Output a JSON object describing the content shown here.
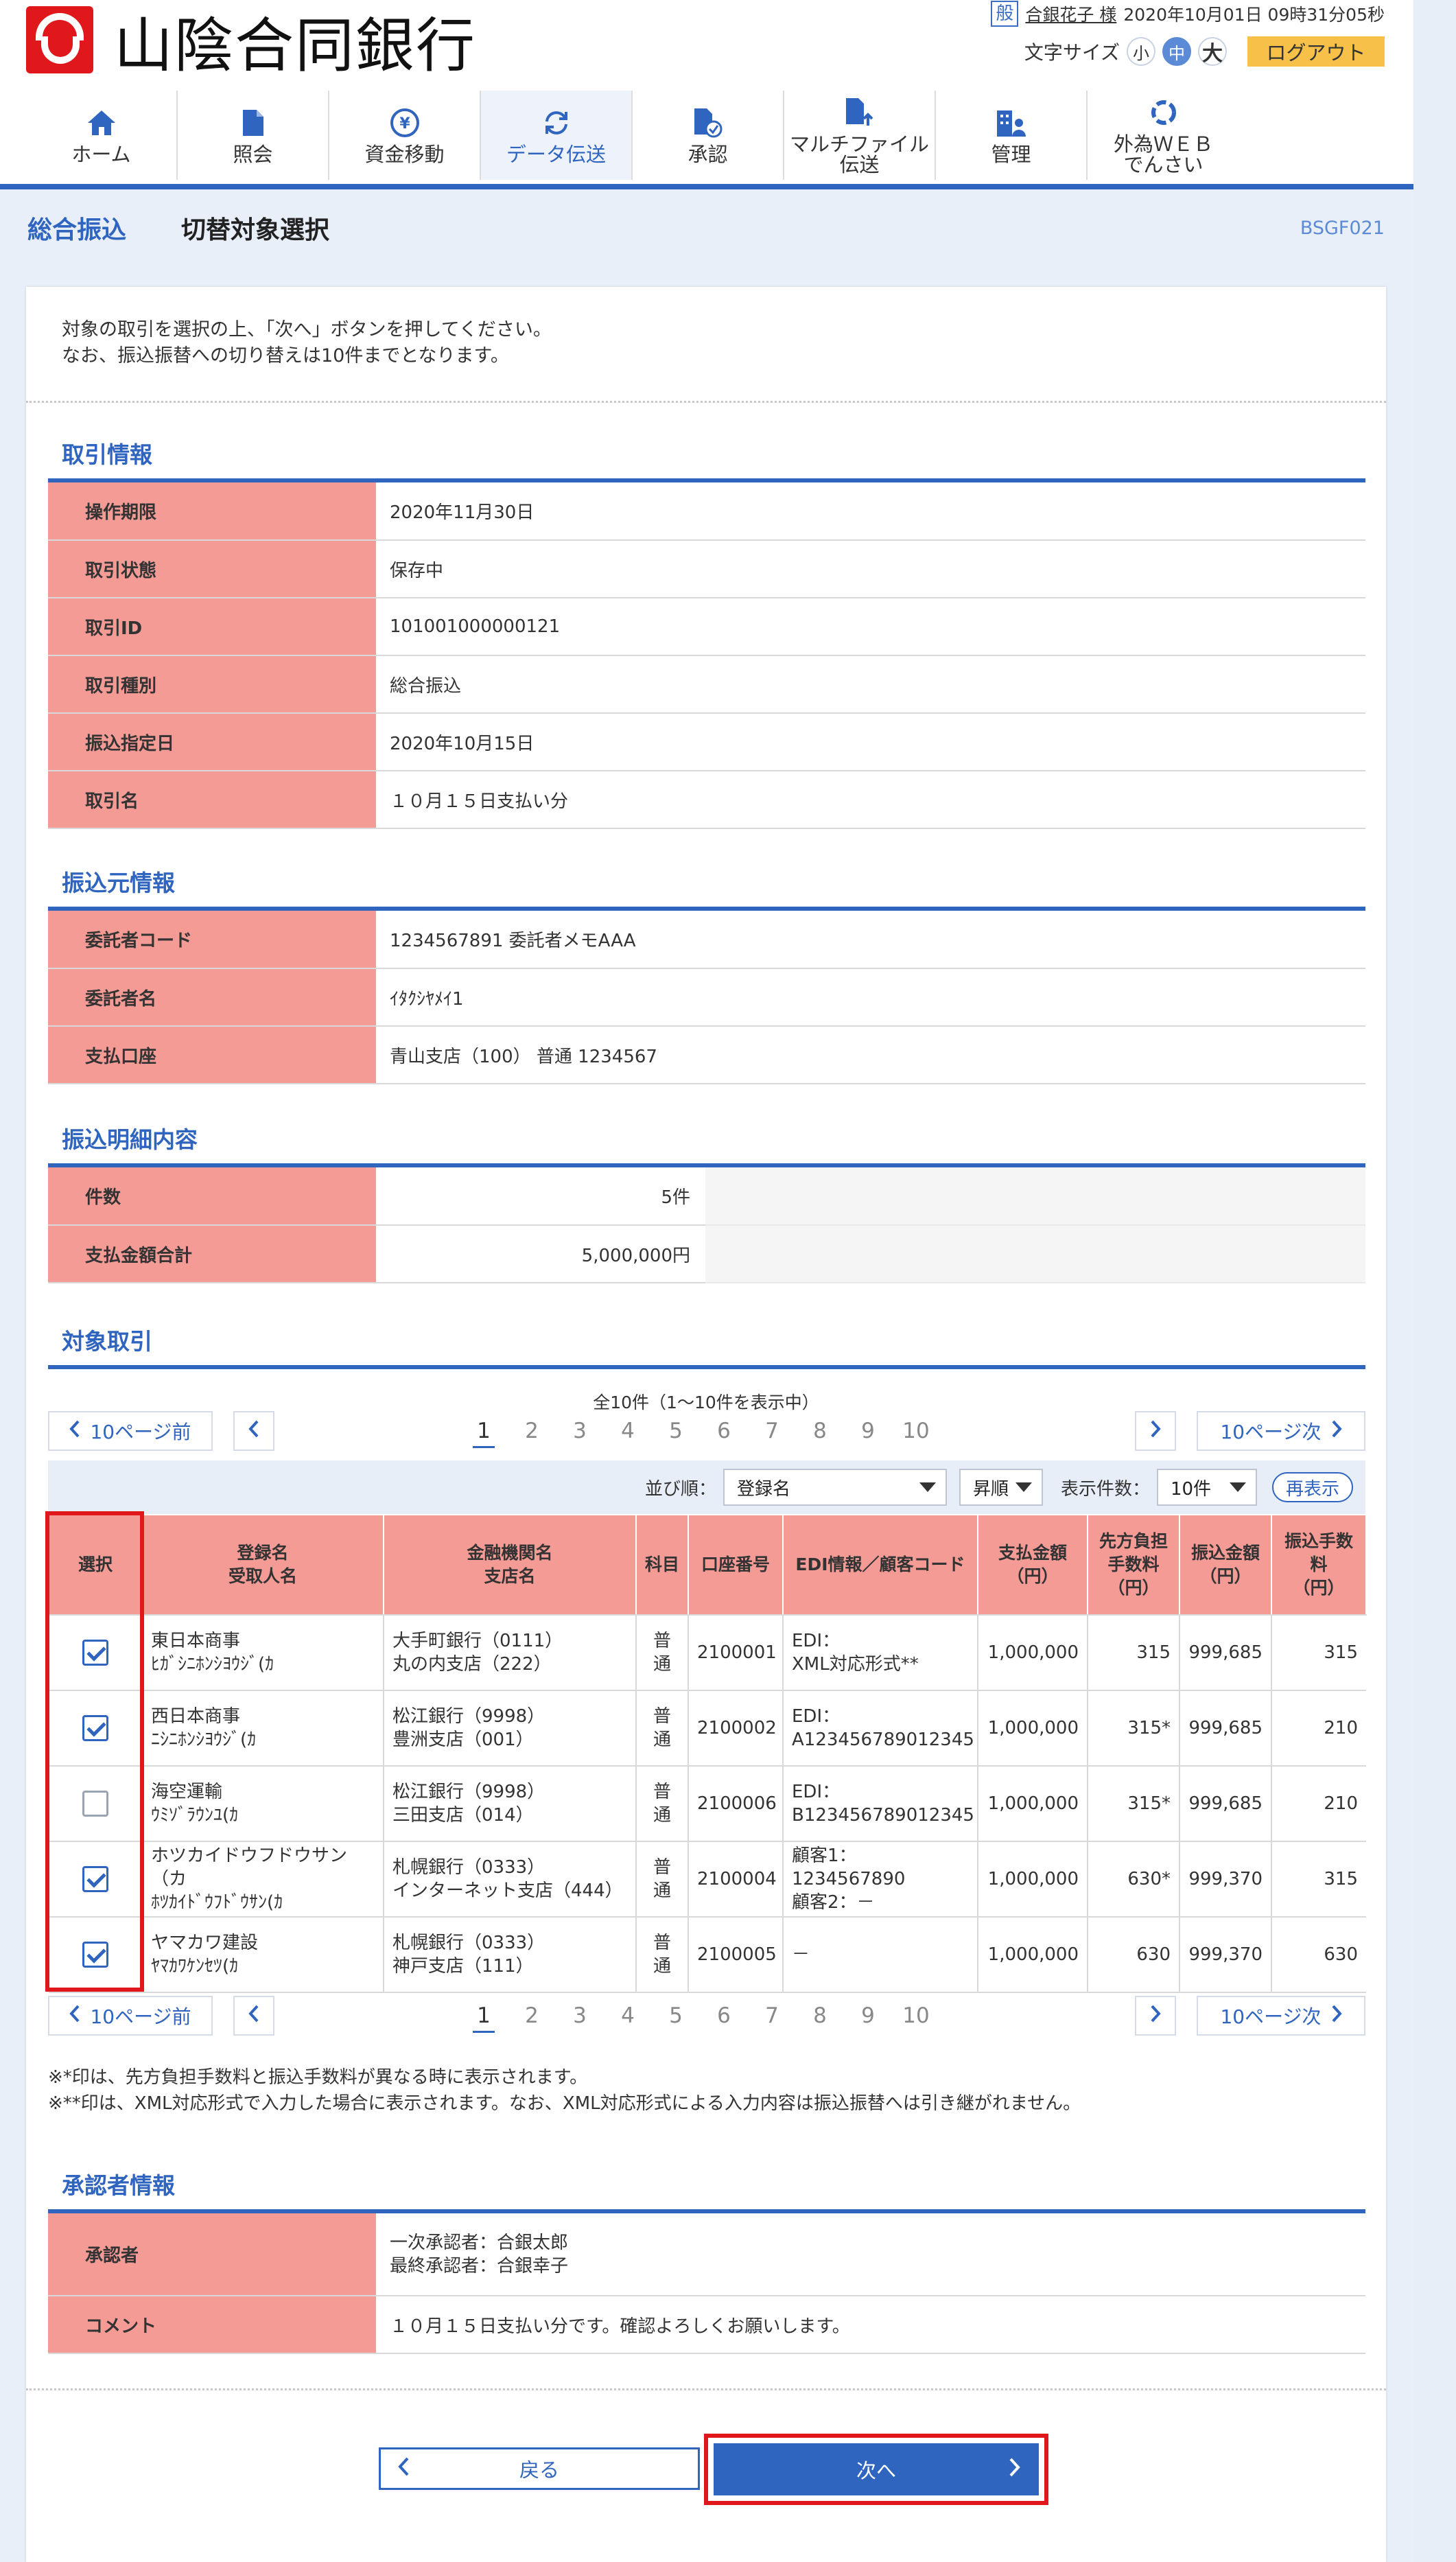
{
  "header": {
    "logo_text": "山陰合同銀行",
    "role_badge": "般",
    "user_name": "合銀花子 様",
    "datetime": "2020年10月01日 09時31分05秒",
    "font_size_label": "文字サイズ",
    "font_sizes": {
      "small": "小",
      "medium": "中",
      "large": "大"
    },
    "logout": "ログアウト"
  },
  "nav": {
    "items": [
      {
        "label": "ホーム",
        "icon": "home-icon"
      },
      {
        "label": "照会",
        "icon": "document-icon"
      },
      {
        "label": "資金移動",
        "icon": "yen-transfer-icon"
      },
      {
        "label": "データ伝送",
        "icon": "refresh-icon"
      },
      {
        "label": "承認",
        "icon": "approval-icon"
      },
      {
        "label": "マルチファイル\n伝送",
        "icon": "file-upload-icon"
      },
      {
        "label": "管理",
        "icon": "building-user-icon"
      },
      {
        "label": "外為ＷＥＢ\nでんさい",
        "icon": "globe-icon"
      }
    ],
    "active_index": 3
  },
  "title": {
    "category": "総合振込",
    "main": "切替対象選択",
    "screen_code": "BSGF021"
  },
  "instructions": {
    "line1": "対象の取引を選択の上、「次へ」ボタンを押してください。",
    "line2": "なお、振込振替への切り替えは10件までとなります。"
  },
  "transaction_info": {
    "title": "取引情報",
    "rows": [
      {
        "label": "操作期限",
        "value": "2020年11月30日"
      },
      {
        "label": "取引状態",
        "value": "保存中"
      },
      {
        "label": "取引ID",
        "value": "101001000000121"
      },
      {
        "label": "取引種別",
        "value": "総合振込"
      },
      {
        "label": "振込指定日",
        "value": "2020年10月15日"
      },
      {
        "label": "取引名",
        "value": "１０月１５日支払い分"
      }
    ]
  },
  "source_info": {
    "title": "振込元情報",
    "rows": [
      {
        "label": "委託者コード",
        "value": "1234567891 委託者メモAAA"
      },
      {
        "label": "委託者名",
        "value": "ｲﾀｸｼﾔﾒｲ1"
      },
      {
        "label": "支払口座",
        "value": "青山支店（100） 普通 1234567"
      }
    ]
  },
  "detail_info": {
    "title": "振込明細内容",
    "rows": [
      {
        "label": "件数",
        "value": "5件"
      },
      {
        "label": "支払金額合計",
        "value": "5,000,000円"
      }
    ]
  },
  "target": {
    "title": "対象取引",
    "count_text": "全10件（1～10件を表示中）",
    "pager": {
      "prev10": "10ページ前",
      "next10": "10ページ次",
      "pages": [
        "1",
        "2",
        "3",
        "4",
        "5",
        "6",
        "7",
        "8",
        "9",
        "10"
      ],
      "current": 1
    },
    "sort": {
      "label": "並び順：",
      "field": "登録名",
      "order": "昇順",
      "per_page_label": "表示件数：",
      "per_page": "10件",
      "redisplay": "再表示"
    },
    "columns": [
      "選択",
      "登録名\n受取人名",
      "金融機関名\n支店名",
      "科目",
      "口座番号",
      "EDI情報／顧客コード",
      "支払金額\n（円）",
      "先方負担\n手数料\n（円）",
      "振込金額\n（円）",
      "振込手数\n料\n（円）"
    ],
    "rows": [
      {
        "selected": true,
        "name": "東日本商事",
        "kana": "ﾋｶﾞｼﾆﾎﾝｼﾖｳｼﾞ(ｶ",
        "bank": "大手町銀行（0111）",
        "branch": "丸の内支店（222）",
        "type": "普通",
        "account": "2100001",
        "edi": "EDI：\nXML対応形式**",
        "amount": "1,000,000",
        "recipient_fee": "315",
        "transfer_amount": "999,685",
        "fee": "315"
      },
      {
        "selected": true,
        "name": "西日本商事",
        "kana": "ﾆｼﾆﾎﾝｼﾖｳｼﾞ(ｶ",
        "bank": "松江銀行（9998）",
        "branch": "豊洲支店（001）",
        "type": "普通",
        "account": "2100002",
        "edi": "EDI：\nA123456789012345",
        "amount": "1,000,000",
        "recipient_fee": "315*",
        "transfer_amount": "999,685",
        "fee": "210"
      },
      {
        "selected": false,
        "name": "海空運輸",
        "kana": "ｳﾐｿﾞﾗｳﾝﾕ(ｶ",
        "bank": "松江銀行（9998）",
        "branch": "三田支店（014）",
        "type": "普通",
        "account": "2100006",
        "edi": "EDI：\nB123456789012345",
        "amount": "1,000,000",
        "recipient_fee": "315*",
        "transfer_amount": "999,685",
        "fee": "210"
      },
      {
        "selected": true,
        "name": "ホツカイドウフドウサン（カ",
        "kana": "ﾎﾂｶｲﾄﾞｳﾌﾄﾞｳｻﾝ(ｶ",
        "bank": "札幌銀行（0333）",
        "branch": "インターネット支店（444）",
        "type": "普通",
        "account": "2100004",
        "edi": "顧客1：1234567890\n顧客2：－",
        "amount": "1,000,000",
        "recipient_fee": "630*",
        "transfer_amount": "999,370",
        "fee": "315"
      },
      {
        "selected": true,
        "name": "ヤマカワ建設",
        "kana": "ﾔﾏｶﾜｹﾝｾﾂ(ｶ",
        "bank": "札幌銀行（0333）",
        "branch": "神戸支店（111）",
        "type": "普通",
        "account": "2100005",
        "edi": "－",
        "amount": "1,000,000",
        "recipient_fee": "630",
        "transfer_amount": "999,370",
        "fee": "630"
      }
    ],
    "notes": [
      "※*印は、先方負担手数料と振込手数料が異なる時に表示されます。",
      "※**印は、XML対応形式で入力した場合に表示されます。なお、XML対応形式による入力内容は振込振替へは引き継がれません。"
    ]
  },
  "approver_info": {
    "title": "承認者情報",
    "approver_label": "承認者",
    "approver_lines": [
      "一次承認者：合銀太郎",
      "最終承認者：合銀幸子"
    ],
    "comment_label": "コメント",
    "comment": "１０月１５日支払い分です。確認よろしくお願いします。"
  },
  "actions": {
    "back": "戻る",
    "next": "次へ"
  },
  "colors": {
    "brand_red": "#e0181b",
    "accent_blue": "#2f64bf",
    "label_bg": "#f49b96",
    "page_bg": "#e9eff9"
  }
}
